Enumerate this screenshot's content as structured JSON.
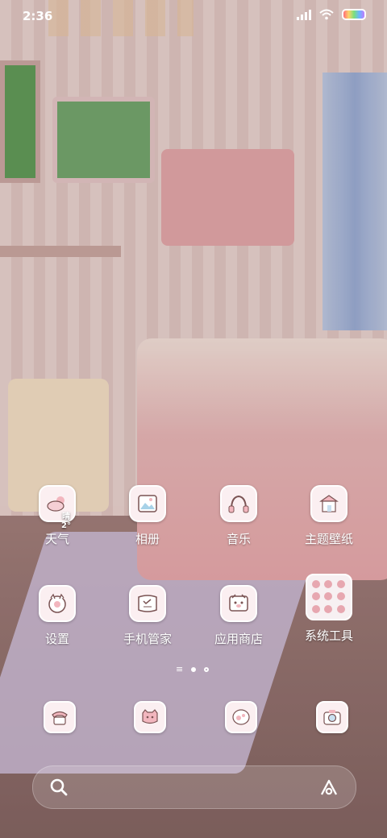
{
  "status_bar": {
    "time": "2:36",
    "icons": [
      "signal-icon",
      "wifi-icon",
      "battery-icon"
    ]
  },
  "apps": [
    {
      "label": "天气",
      "icon": "weather-icon",
      "temp": "晴 2°"
    },
    {
      "label": "相册",
      "icon": "gallery-icon"
    },
    {
      "label": "音乐",
      "icon": "music-icon"
    },
    {
      "label": "主题壁纸",
      "icon": "theme-icon"
    },
    {
      "label": "设置",
      "icon": "settings-icon"
    },
    {
      "label": "手机管家",
      "icon": "security-icon"
    },
    {
      "label": "应用商店",
      "icon": "app-store-icon"
    },
    {
      "label": "系统工具",
      "icon": "folder-icon"
    }
  ],
  "page_indicator": {
    "pages": 3,
    "current": 2
  },
  "dock": [
    {
      "icon": "phone-icon"
    },
    {
      "icon": "messages-icon"
    },
    {
      "icon": "browser-icon"
    },
    {
      "icon": "camera-icon"
    }
  ],
  "search": {
    "left_icon": "search-icon",
    "right_icon": "assistant-icon"
  }
}
